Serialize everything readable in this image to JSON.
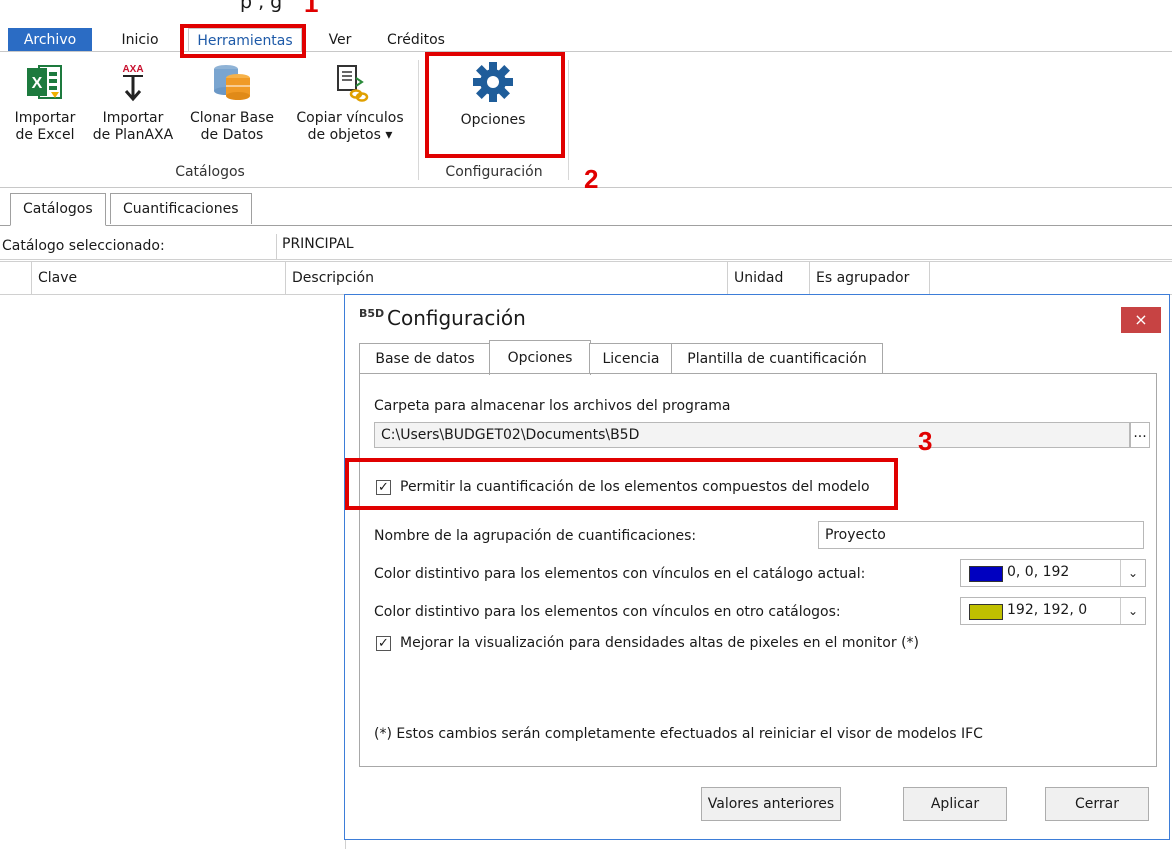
{
  "top_fragment": "p         ,                                                                g",
  "ribbon_tabs": [
    "Archivo",
    "Inicio",
    "Herramientas",
    "Ver",
    "Créditos"
  ],
  "ribbon": {
    "buttons": [
      {
        "line1": "Importar",
        "line2": "de Excel"
      },
      {
        "line1": "Importar",
        "line2": "de PlanAXA"
      },
      {
        "line1": "Clonar Base",
        "line2": "de Datos"
      },
      {
        "line1": "Copiar vínculos",
        "line2": "de objetos ▾"
      },
      {
        "line1": "Opciones",
        "line2": ""
      }
    ],
    "group_catalogos": "Catálogos",
    "group_config": "Configuración",
    "axa_logo": "AXA"
  },
  "doc_tabs": [
    "Catálogos",
    "Cuantificaciones"
  ],
  "catalog": {
    "label": "Catálogo seleccionado:",
    "value": "PRINCIPAL"
  },
  "grid_headers": [
    "Clave",
    "Descripción",
    "Unidad",
    "Es agrupador"
  ],
  "dialog": {
    "logo": "B5D",
    "title": "Configuración",
    "close": "×",
    "tabs": [
      "Base de datos",
      "Opciones",
      "Licencia",
      "Plantilla de cuantificación"
    ],
    "folder_label": "Carpeta para almacenar los archivos del programa",
    "folder_value": "C:\\Users\\BUDGET02\\Documents\\B5D",
    "browse": "...",
    "compound_check_label": "Permitir la cuantificación de los elementos compuestos del modelo",
    "group_name_label": "Nombre de la agrupación de cuantificaciones:",
    "group_name_value": "Proyecto",
    "color_current_label": "Color distintivo para los elementos con vínculos en el catálogo actual:",
    "color_current_value": "0, 0, 192",
    "color_current_hex": "#0000c0",
    "color_other_label": "Color distintivo para los elementos con vínculos en otro catálogos:",
    "color_other_value": "192, 192, 0",
    "color_other_hex": "#c0c000",
    "hidpi_check_label": "Mejorar la visualización para densidades altas de pixeles en el monitor (*)",
    "note": "(*) Estos cambios serán completamente efectuados al reiniciar el visor de modelos IFC",
    "buttons": [
      "Valores anteriores",
      "Aplicar",
      "Cerrar"
    ]
  },
  "annotations": [
    "1",
    "2",
    "3"
  ]
}
